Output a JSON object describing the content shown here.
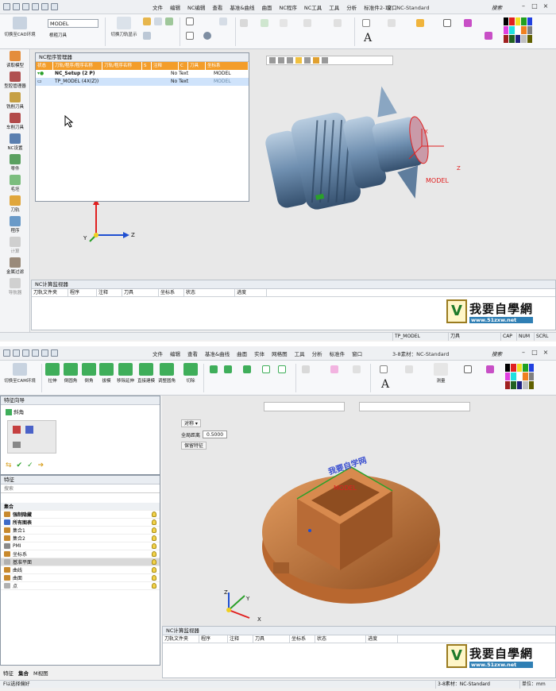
{
  "top": {
    "menu": [
      "文件",
      "编辑",
      "NC编辑",
      "查看",
      "基准&曲线",
      "曲面",
      "NC程序",
      "NC工具",
      "工具",
      "分析",
      "标准件",
      "窗口"
    ],
    "window_title": "2-12：NC-Standard",
    "search_label": "搜索",
    "ribbon": {
      "switch_cad_label": "切换至CAD环境",
      "model_combo": "MODEL",
      "roughing_tool_label": "根粗刀具",
      "toolpath_display_label": "切换刀轨显示"
    },
    "left_toolbar": [
      "读取模型",
      "型腔管理器",
      "铣削刀具",
      "车削刀具",
      "NC设置",
      "零件",
      "毛坯",
      "刀轨",
      "程序",
      "计算",
      "金属过滤",
      "导航器"
    ],
    "nc_manager": {
      "title": "NC程序管理器",
      "columns": [
        "状态",
        "刀轨/程序/程序名称",
        "刀轨/程序名称",
        "S",
        "注释",
        "C",
        "刀具",
        "坐标系"
      ],
      "rows": [
        {
          "name": "NC_Setup (2 P)",
          "note": "No Text",
          "cs": "MODEL"
        },
        {
          "name": "TP_MODEL (4X(Z))",
          "note": "No Text",
          "cs": "MODEL"
        }
      ]
    },
    "model_label": "MODEL",
    "axis": {
      "x": "X",
      "y": "Y",
      "z": "Z"
    },
    "monitor": {
      "title": "NC计算监视器",
      "columns": [
        "刀轨文件夹",
        "程序",
        "注释",
        "刀具",
        "坐标系",
        "状态",
        "进度"
      ]
    },
    "status": {
      "left": "TP_MODEL",
      "tool": "刀具",
      "caps": "CAP",
      "num": "NUM",
      "scrl": "SCRL"
    }
  },
  "bottom": {
    "menu": [
      "文件",
      "编辑",
      "查看",
      "基准&曲线",
      "曲面",
      "实体",
      "网格图",
      "工具",
      "分析",
      "标准件",
      "窗口"
    ],
    "window_title": "3-8素材：NC-Standard",
    "search_label": "搜索",
    "ribbon": {
      "switch_cad_label": "切换至CAM环境",
      "groups": [
        "拉伸",
        "倒圆角",
        "倒角",
        "拔模",
        "移除延伸",
        "直接建模",
        "调整圆角",
        "切除"
      ],
      "dim_label": "测量"
    },
    "feature_guide": {
      "title": "特征向导",
      "item": "斜角"
    },
    "feature_tree": {
      "title": "特征",
      "search_placeholder": "搜索",
      "header": "集合",
      "items": [
        "强制隐藏",
        "所有图表",
        "集合1",
        "集合2",
        "PMI",
        "坐标系",
        "基准平面",
        "曲线",
        "曲面",
        "点"
      ]
    },
    "tabs": [
      "特征",
      "集合",
      "M视图"
    ],
    "property": {
      "align_label": "对称",
      "distance_label": "全局距离",
      "distance_value": "0.5000",
      "keep_label": "保留特征"
    },
    "model_text": "我要自学网",
    "model_label": "MODEL",
    "axis": {
      "x": "X",
      "y": "Y",
      "z": "Z"
    },
    "monitor": {
      "title": "NC计算监视器",
      "columns": [
        "刀轨文件夹",
        "程序",
        "注释",
        "刀具",
        "坐标系",
        "状态",
        "进度"
      ]
    },
    "status": {
      "left": "F以选择偏好",
      "center": "3-8素材：NC-Standard",
      "unit": "单位：mm"
    }
  },
  "logo": {
    "cn": "我要自學網",
    "url": "www.51zxw.net"
  },
  "colors": {
    "accent": "#f39d2a",
    "part_blue": "#6f8fb0",
    "part_copper": "#c9773c",
    "axis_red": "#e02020",
    "axis_blue": "#1f4fd1",
    "axis_green": "#2aa02a"
  }
}
